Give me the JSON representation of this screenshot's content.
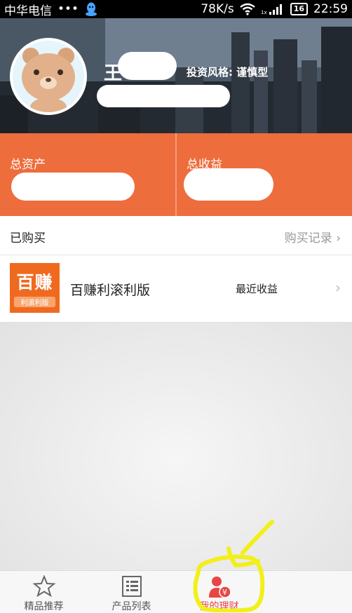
{
  "status_bar": {
    "carrier": "中华电信",
    "dots": "•••",
    "speed": "78K/s",
    "battery": "16",
    "time": "22:59",
    "icons": [
      "qq-icon",
      "wifi-icon",
      "signal-icon",
      "battery-icon"
    ]
  },
  "profile": {
    "username": "王 ",
    "risk_label": "投资风格: 谨慎型"
  },
  "assets": {
    "total_assets_label": "总资产",
    "total_income_label": "总收益"
  },
  "purchased": {
    "title": "已购买",
    "record_link": "购买记录"
  },
  "product": {
    "logo_text": "百赚",
    "logo_subtext": "利滚利版",
    "name": "百赚利滚利版",
    "recent_income_label": "最近收益"
  },
  "tabs": [
    {
      "label": "精品推荐",
      "icon": "star-icon"
    },
    {
      "label": "产品列表",
      "icon": "list-icon"
    },
    {
      "label": "我的理财",
      "icon": "user-money-icon",
      "active": true
    },
    {
      "label": "",
      "icon": ""
    }
  ],
  "colors": {
    "accent_orange": "#ee6d3c",
    "active_tab": "#e84646",
    "annotation": "#f2ef1a"
  }
}
